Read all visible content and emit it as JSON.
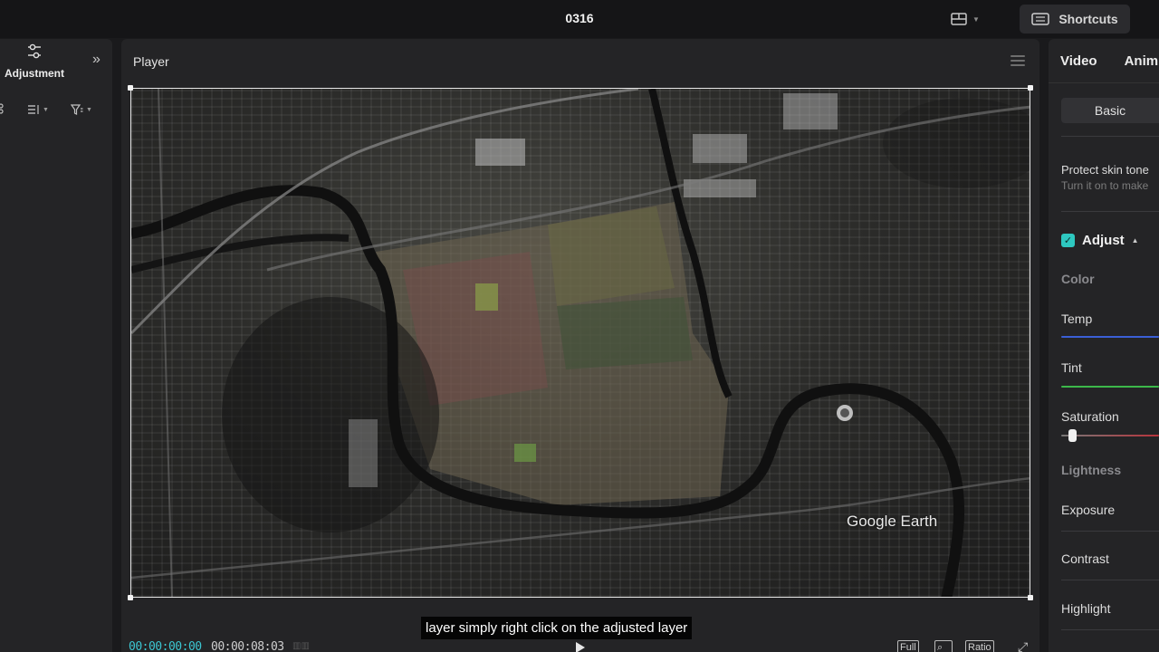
{
  "topbar": {
    "title": "0316",
    "shortcuts_label": "Shortcuts"
  },
  "left_panel": {
    "adjustment_label": "Adjustment"
  },
  "player": {
    "title": "Player",
    "watermark": "Google Earth",
    "timecode_current": "00:00:00:00",
    "timecode_total": "00:00:08:03",
    "full_label": "Full",
    "ratio_label": "Ratio"
  },
  "caption": {
    "text": "layer simply right click on the adjusted layer"
  },
  "right_panel": {
    "tabs": [
      {
        "label": "Video"
      },
      {
        "label": "Anim"
      }
    ],
    "basic_label": "Basic",
    "protect_skin_tone": {
      "label": "Protect skin tone",
      "description": "Turn it on to make"
    },
    "adjust_label": "Adjust",
    "sections": {
      "color": "Color",
      "lightness": "Lightness"
    },
    "rows": {
      "temp": "Temp",
      "tint": "Tint",
      "saturation": "Saturation",
      "exposure": "Exposure",
      "contrast": "Contrast",
      "highlight": "Highlight"
    }
  },
  "colors": {
    "accent": "#3cc8d4",
    "check": "#2ec8c0",
    "temp_slider": "#3a5fd6",
    "tint_slider": "#3cb84a",
    "saturation_slider": "#b8343c"
  }
}
